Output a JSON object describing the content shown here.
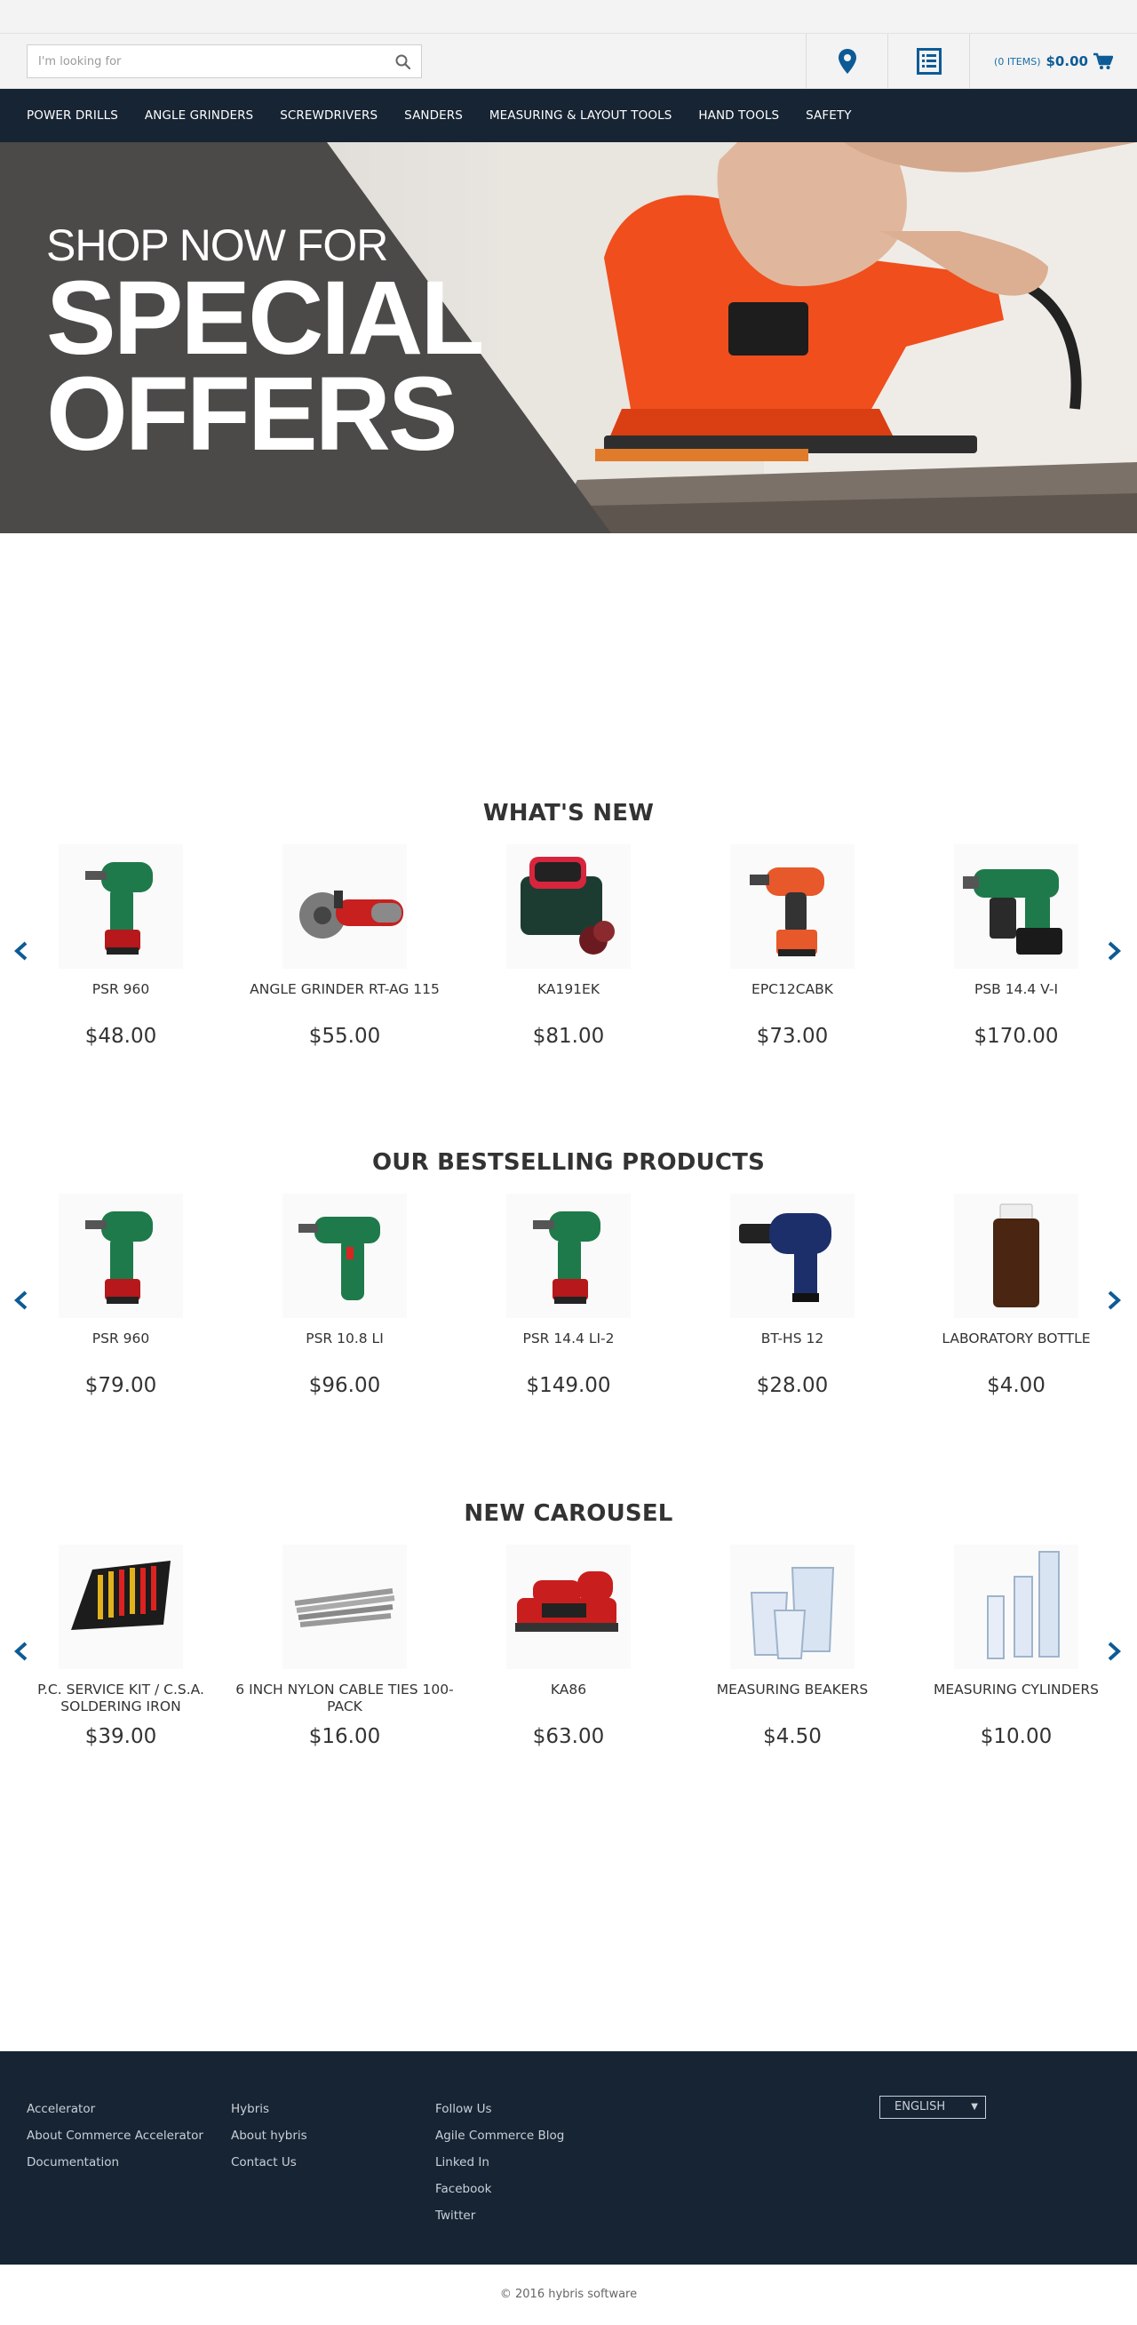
{
  "search": {
    "placeholder": "I'm looking for"
  },
  "header": {
    "cart_items": "(0 ITEMS)",
    "cart_total": "$0.00"
  },
  "nav": {
    "items": [
      "POWER DRILLS",
      "ANGLE GRINDERS",
      "SCREWDRIVERS",
      "SANDERS",
      "MEASURING & LAYOUT TOOLS",
      "HAND TOOLS",
      "SAFETY"
    ]
  },
  "hero": {
    "kicker": "SHOP NOW FOR",
    "title_line1": "SPECIAL",
    "title_line2": "OFFERS"
  },
  "sections": [
    {
      "title": "WHAT'S NEW",
      "products": [
        {
          "name": "PSR 960",
          "price": "$48.00",
          "icon": "green-drill"
        },
        {
          "name": "ANGLE GRINDER RT-AG 115",
          "price": "$55.00",
          "icon": "angle-grinder"
        },
        {
          "name": "KA191EK",
          "price": "$81.00",
          "icon": "sander-kit"
        },
        {
          "name": "EPC12CABK",
          "price": "$73.00",
          "icon": "orange-drill"
        },
        {
          "name": "PSB 14.4 V-I",
          "price": "$170.00",
          "icon": "hammer-drill"
        }
      ]
    },
    {
      "title": "OUR BESTSELLING PRODUCTS",
      "products": [
        {
          "name": "PSR 960",
          "price": "$79.00",
          "icon": "green-drill"
        },
        {
          "name": "PSR 10.8 LI",
          "price": "$96.00",
          "icon": "green-screwdriver"
        },
        {
          "name": "PSR 14.4 LI-2",
          "price": "$149.00",
          "icon": "green-drill"
        },
        {
          "name": "BT-HS 12",
          "price": "$28.00",
          "icon": "heat-gun"
        },
        {
          "name": "LABORATORY BOTTLE",
          "price": "$4.00",
          "icon": "bottle"
        }
      ]
    },
    {
      "title": "NEW CAROUSEL",
      "products": [
        {
          "name": "P.C. SERVICE KIT / C.S.A. SOLDERING IRON",
          "price": "$39.00",
          "icon": "tool-kit"
        },
        {
          "name": "6 INCH NYLON CABLE TIES 100-PACK",
          "price": "$16.00",
          "icon": "cable-ties"
        },
        {
          "name": "KA86",
          "price": "$63.00",
          "icon": "belt-sander"
        },
        {
          "name": "MEASURING BEAKERS",
          "price": "$4.50",
          "icon": "beakers"
        },
        {
          "name": "MEASURING CYLINDERS",
          "price": "$10.00",
          "icon": "cylinders"
        }
      ]
    }
  ],
  "footer": {
    "col1": [
      "Accelerator",
      "About Commerce Accelerator",
      "Documentation"
    ],
    "col2": [
      "Hybris",
      "About hybris",
      "Contact Us"
    ],
    "col3": [
      "Follow Us",
      "Agile Commerce Blog",
      "Linked In",
      "Facebook",
      "Twitter"
    ],
    "language": "ENGLISH",
    "copyright": "© 2016 hybris software"
  },
  "colors": {
    "nav_bg": "#172433",
    "accent_blue": "#0d5b96",
    "hero_dark": "#4b4a48",
    "sander_orange": "#f04e1c"
  }
}
